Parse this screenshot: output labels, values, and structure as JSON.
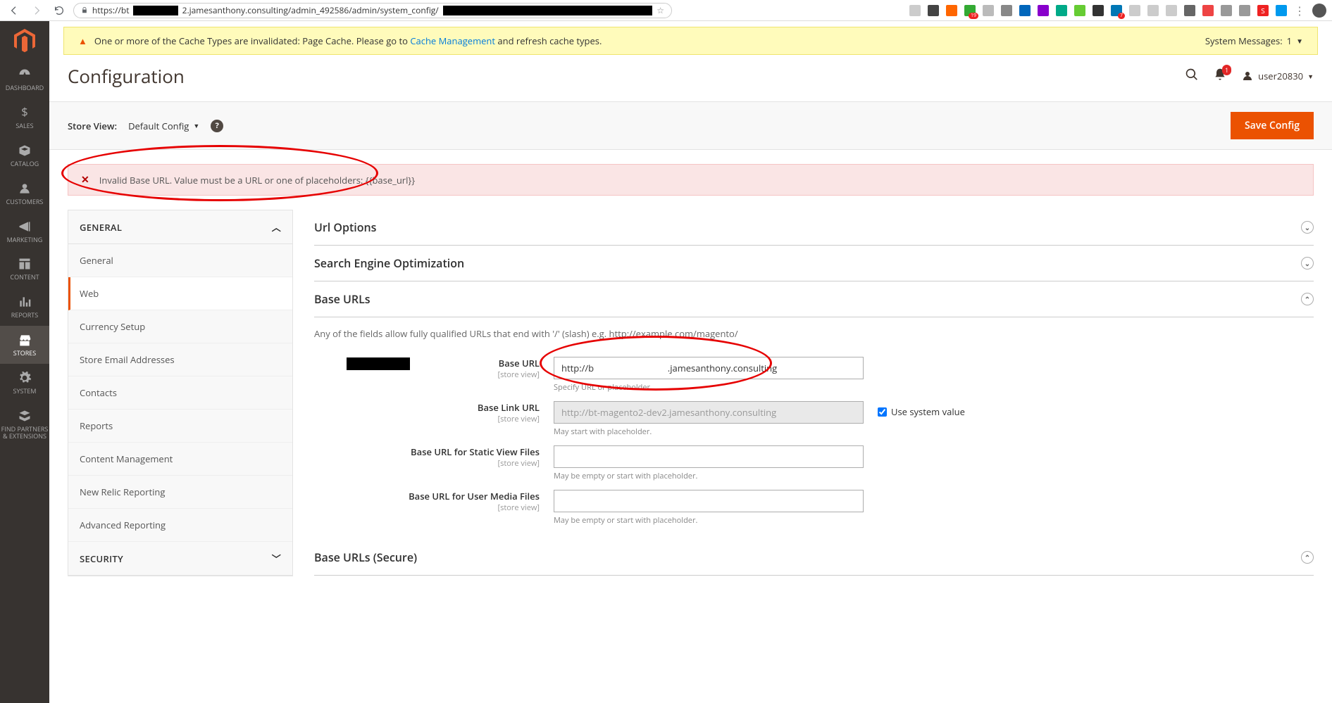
{
  "browser": {
    "url_prefix": "https://bt",
    "url_mid": "2.jamesanthony.consulting/admin_492586/admin/system_config/"
  },
  "sys_message": {
    "text_before_link": "One or more of the Cache Types are invalidated: Page Cache. Please go to ",
    "link_text": "Cache Management",
    "text_after_link": " and refresh cache types.",
    "right_label": "System Messages:",
    "right_count": "1"
  },
  "page": {
    "title": "Configuration"
  },
  "user": {
    "name": "user20830"
  },
  "notif": {
    "count": "1"
  },
  "toolbar": {
    "label": "Store View:",
    "scope": "Default Config",
    "save": "Save Config"
  },
  "error": {
    "text": "Invalid Base URL. Value must be a URL or one of placeholders: {{base_url}}"
  },
  "nav": {
    "dashboard": "DASHBOARD",
    "sales": "SALES",
    "catalog": "CATALOG",
    "customers": "CUSTOMERS",
    "marketing": "MARKETING",
    "content": "CONTENT",
    "reports": "REPORTS",
    "stores": "STORES",
    "system": "SYSTEM",
    "partners": "FIND PARTNERS\n& EXTENSIONS"
  },
  "sidebar": {
    "group_general": "GENERAL",
    "items": [
      "General",
      "Web",
      "Currency Setup",
      "Store Email Addresses",
      "Contacts",
      "Reports",
      "Content Management",
      "New Relic Reporting",
      "Advanced Reporting"
    ],
    "group_security": "SECURITY"
  },
  "sections": {
    "url_options": "Url Options",
    "seo": "Search Engine Optimization",
    "base_urls": "Base URLs",
    "base_urls_secure": "Base URLs (Secure)",
    "base_urls_desc": "Any of the fields allow fully qualified URLs that end with '/' (slash) e.g. http://example.com/magento/"
  },
  "fields": {
    "base_url": {
      "label": "Base URL",
      "scope": "[store view]",
      "value": "http://b                               .jamesanthony.consulting",
      "hint": "Specify URL or placeholder."
    },
    "base_link_url": {
      "label": "Base Link URL",
      "scope": "[store view]",
      "placeholder": "http://bt-magento2-dev2.jamesanthony.consulting",
      "hint": "May start with placeholder.",
      "checkbox": "Use system value"
    },
    "base_static": {
      "label": "Base URL for Static View Files",
      "scope": "[store view]",
      "hint": "May be empty or start with placeholder."
    },
    "base_media": {
      "label": "Base URL for User Media Files",
      "scope": "[store view]",
      "hint": "May be empty or start with placeholder."
    }
  }
}
